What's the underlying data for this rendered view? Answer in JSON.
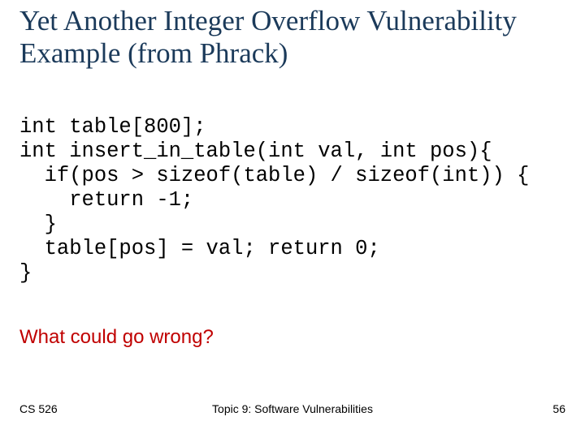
{
  "slide": {
    "title": "Yet Another Integer Overflow Vulnerability Example (from Phrack)",
    "code": "int table[800];\nint insert_in_table(int val, int pos){\n  if(pos > sizeof(table) / sizeof(int)) {\n    return -1;\n  }\n  table[pos] = val; return 0;\n}",
    "question": "What could go wrong?",
    "footer": {
      "left": "CS 526",
      "center": "Topic 9: Software Vulnerabilities",
      "right": "56"
    }
  }
}
